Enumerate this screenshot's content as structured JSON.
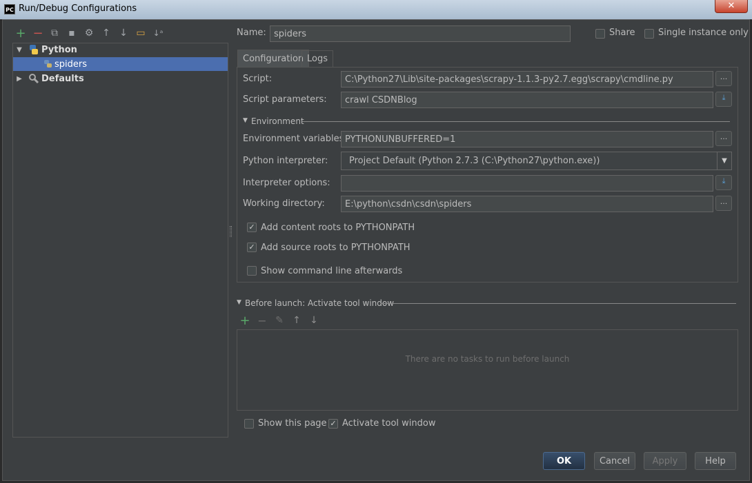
{
  "window": {
    "app_icon": "PC",
    "title": "Run/Debug Configurations",
    "close_glyph": "✕"
  },
  "toolbar": {
    "add": "+",
    "remove": "−",
    "copy": "⧉",
    "save": "▪",
    "edit_defaults": "⚙",
    "move_up": "↑",
    "move_down": "↓",
    "folder": "▭",
    "sort": "↓ᵃ",
    "colors": {
      "add": "#59a869",
      "remove": "#c75450",
      "folder": "#d9a343"
    }
  },
  "tree": {
    "python": {
      "expand": "▼",
      "label": "Python"
    },
    "spiders": {
      "label": "spiders"
    },
    "defaults": {
      "expand": "▶",
      "label": "Defaults"
    }
  },
  "name": {
    "label": "Name:",
    "value": "spiders"
  },
  "share": {
    "label": "Share",
    "checked": false
  },
  "single_instance": {
    "label": "Single instance only",
    "checked": false
  },
  "tabs": [
    {
      "label": "Configuration",
      "active": true
    },
    {
      "label": "Logs",
      "active": false
    }
  ],
  "form": {
    "script": {
      "label": "Script:",
      "value": "C:\\Python27\\Lib\\site-packages\\scrapy-1.1.3-py2.7.egg\\scrapy\\cmdline.py",
      "browse": "..."
    },
    "script_params": {
      "label": "Script parameters:",
      "value": "crawl CSDNBlog",
      "expand": "⤓"
    },
    "environment": {
      "label": "Environment",
      "toggle": "▼"
    },
    "env_vars": {
      "label": "Environment variables:",
      "value": "PYTHONUNBUFFERED=1",
      "browse": "..."
    },
    "interpreter": {
      "label": "Python interpreter:",
      "value": "Project Default (Python 2.7.3 (C:\\Python27\\python.exe))",
      "dropdown": "▼"
    },
    "interp_options": {
      "label": "Interpreter options:",
      "value": "",
      "expand": "⤓"
    },
    "working_dir": {
      "label": "Working directory:",
      "value": "E:\\python\\csdn\\csdn\\spiders",
      "browse": "..."
    },
    "content_roots": {
      "label": "Add content roots to PYTHONPATH",
      "checked": true,
      "mark": "✓"
    },
    "source_roots": {
      "label": "Add source roots to PYTHONPATH",
      "checked": true,
      "mark": "✓"
    },
    "show_cmdline": {
      "label": "Show command line afterwards",
      "checked": false
    }
  },
  "before_launch": {
    "toggle": "▼",
    "label": "Before launch: Activate tool window",
    "toolbar": {
      "add": "+",
      "remove": "−",
      "edit": "✎",
      "up": "↑",
      "down": "↓"
    },
    "empty_text": "There are no tasks to run before launch"
  },
  "show_page": {
    "label": "Show this page",
    "checked": false
  },
  "activate_tool": {
    "label": "Activate tool window",
    "checked": true,
    "mark": "✓"
  },
  "buttons": {
    "ok": "OK",
    "cancel": "Cancel",
    "apply": "Apply",
    "help": "Help"
  },
  "colors": {
    "accent": "#4b6eaf",
    "background": "#3c3f41",
    "field": "#45494a"
  }
}
